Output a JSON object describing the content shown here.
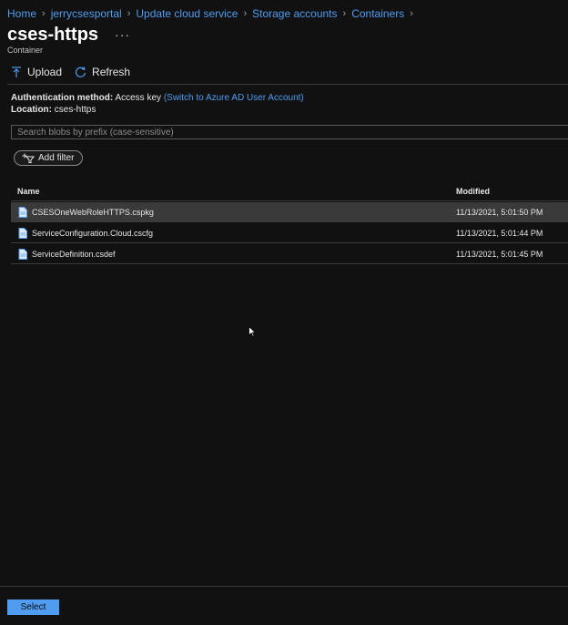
{
  "breadcrumb": [
    "Home",
    "jerrycsesportal",
    "Update cloud service",
    "Storage accounts",
    "Containers"
  ],
  "page": {
    "title": "cses-https",
    "subtitle": "Container",
    "more": "···"
  },
  "toolbar": {
    "upload_label": "Upload",
    "refresh_label": "Refresh"
  },
  "info": {
    "auth_label": "Authentication method:",
    "auth_value": "Access key",
    "auth_switch": "(Switch to Azure AD User Account)",
    "location_label": "Location:",
    "location_value": "cses-https"
  },
  "search": {
    "placeholder": "Search blobs by prefix (case-sensitive)"
  },
  "filter": {
    "label": "Add filter"
  },
  "table": {
    "columns": [
      "Name",
      "Modified"
    ],
    "rows": [
      {
        "name": "CSESOneWebRoleHTTPS.cspkg",
        "modified": "11/13/2021, 5:01:50 PM",
        "selected": true
      },
      {
        "name": "ServiceConfiguration.Cloud.cscfg",
        "modified": "11/13/2021, 5:01:44 PM",
        "selected": false
      },
      {
        "name": "ServiceDefinition.csdef",
        "modified": "11/13/2021, 5:01:45 PM",
        "selected": false
      }
    ]
  },
  "footer": {
    "select_label": "Select"
  },
  "colors": {
    "background": "#111111",
    "link": "#4f9cf0",
    "selected_row": "#3a3a3a",
    "primary_button": "#4f9cf0"
  }
}
